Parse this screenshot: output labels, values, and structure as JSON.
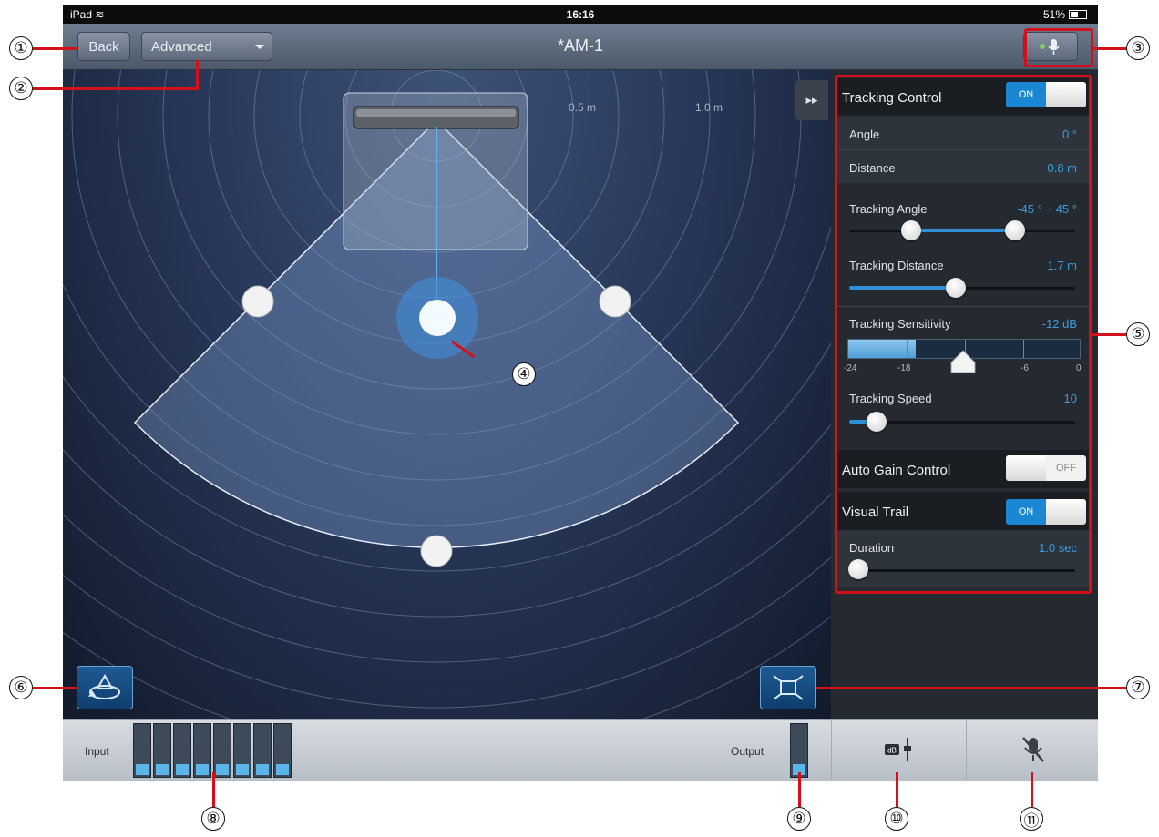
{
  "status_bar": {
    "device": "iPad",
    "time": "16:16",
    "battery": "51%"
  },
  "nav": {
    "back_label": "Back",
    "mode_label": "Advanced",
    "title": "*AM-1"
  },
  "stage": {
    "distance_labels": [
      "0.5 m",
      "1.0 m"
    ]
  },
  "panel": {
    "tracking_control": {
      "label": "Tracking Control",
      "state": "ON"
    },
    "angle": {
      "label": "Angle",
      "value": "0 °"
    },
    "distance": {
      "label": "Distance",
      "value": "0.8 m"
    },
    "tracking_angle": {
      "label": "Tracking Angle",
      "value": "-45 ° ~ 45 °",
      "range_deg": [
        -45,
        45
      ]
    },
    "tracking_distance": {
      "label": "Tracking Distance",
      "value": "1.7 m",
      "level": 0.47
    },
    "tracking_sensitivity": {
      "label": "Tracking Sensitivity",
      "value": "-12 dB",
      "ticks": [
        "-24",
        "-18",
        "-6",
        "0"
      ]
    },
    "tracking_speed": {
      "label": "Tracking Speed",
      "value": "10",
      "level": 0.12
    },
    "auto_gain_control": {
      "label": "Auto Gain Control",
      "state": "OFF"
    },
    "visual_trail": {
      "label": "Visual Trail",
      "state": "ON"
    },
    "duration": {
      "label": "Duration",
      "value": "1.0 sec",
      "level": 0.04
    }
  },
  "bottom": {
    "input_label": "Input",
    "output_label": "Output"
  },
  "callouts": [
    "①",
    "②",
    "③",
    "④",
    "⑤",
    "⑥",
    "⑦",
    "⑧",
    "⑨",
    "⑩",
    "⑪"
  ],
  "colors": {
    "accent": "#1b87d2",
    "callout_red": "#d4111a",
    "stage_bg": "#28385a"
  },
  "icons": [
    "wifi-icon",
    "battery-icon",
    "mic-icon",
    "fast-forward-icon",
    "rotate-view-icon",
    "fit-view-icon",
    "db-fader-icon",
    "mic-mute-icon"
  ]
}
